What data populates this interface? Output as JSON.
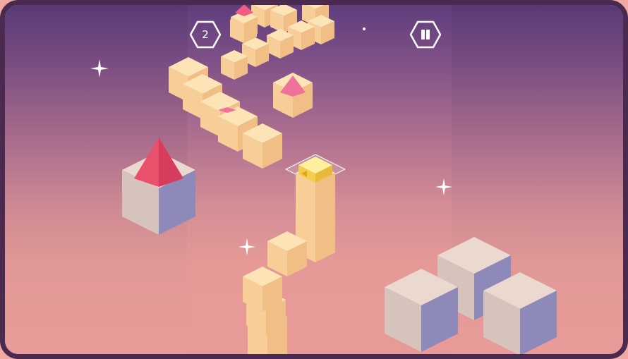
{
  "hud": {
    "score": "2",
    "score_icon": "hexagon-icon",
    "pause_icon": "pause-icon"
  },
  "colors": {
    "sky_top": "#5e3d7c",
    "sky_bottom": "#e89a97",
    "path_cube_top": "#fde1b0",
    "path_cube_side": "#f4c78f",
    "obstacle_top": "#e8d6cf",
    "obstacle_side": "#8c89b8",
    "pyramid": "#ef5c76",
    "player": "#f6d25b",
    "frame": "#4a2a4e"
  }
}
